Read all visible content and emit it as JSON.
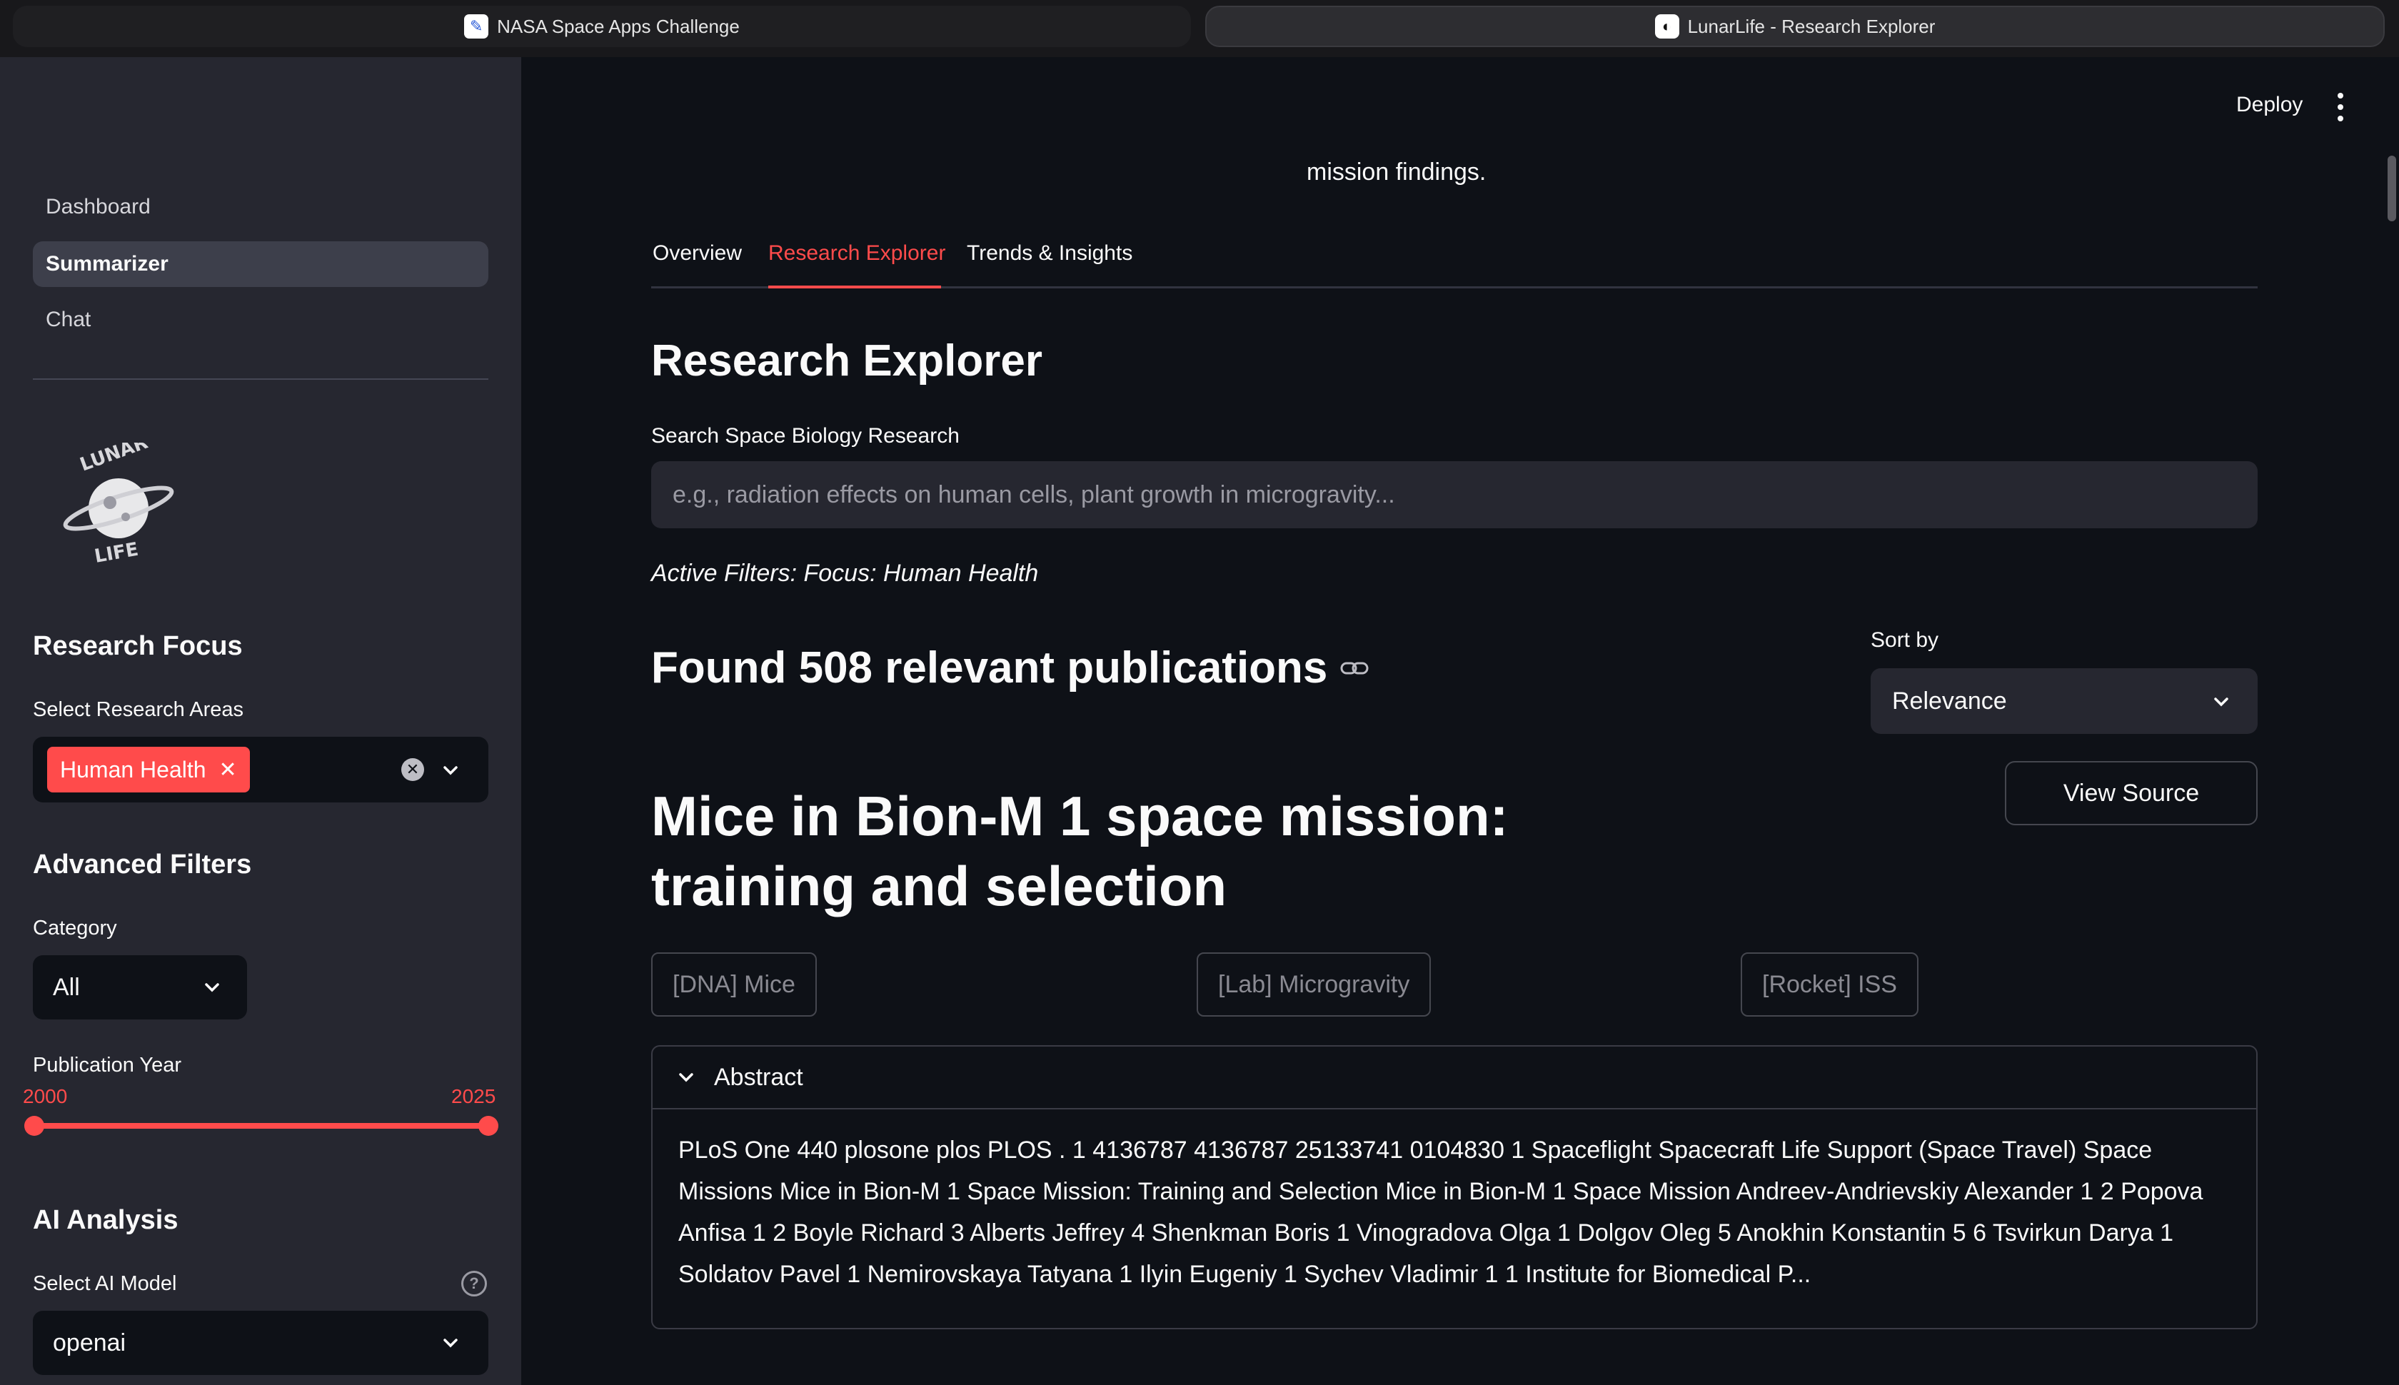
{
  "browser": {
    "tabs": [
      {
        "title": "NASA Space Apps Challenge",
        "icon": "nasa-spaceapps-icon"
      },
      {
        "title": "LunarLife - Research Explorer",
        "icon": "lunarlife-icon"
      }
    ]
  },
  "sidebar": {
    "nav": [
      {
        "label": "Dashboard",
        "active": false
      },
      {
        "label": "Summarizer",
        "active": true
      },
      {
        "label": "Chat",
        "active": false
      }
    ],
    "logo_text": "LUNAR LIFE",
    "research_focus": {
      "heading": "Research Focus",
      "label": "Select Research Areas",
      "selected": [
        "Human Health"
      ]
    },
    "advanced_filters": {
      "heading": "Advanced Filters",
      "category_label": "Category",
      "category_value": "All",
      "year_label": "Publication Year",
      "year_min": "2000",
      "year_max": "2025"
    },
    "ai_analysis": {
      "heading": "AI Analysis",
      "model_label": "Select AI Model",
      "model_value": "openai"
    }
  },
  "header": {
    "deploy_label": "Deploy"
  },
  "main": {
    "intro_tail": "mission findings.",
    "tabs": [
      {
        "label": "Overview",
        "active": false
      },
      {
        "label": "Research Explorer",
        "active": true
      },
      {
        "label": "Trends & Insights",
        "active": false
      }
    ],
    "heading": "Research Explorer",
    "search_label": "Search Space Biology Research",
    "search_placeholder": "e.g., radiation effects on human cells, plant growth in microgravity...",
    "active_filters": "Active Filters: Focus: Human Health",
    "found_text": "Found 508 relevant publications",
    "sort_label": "Sort by",
    "sort_value": "Relevance",
    "view_source_label": "View Source",
    "publication": {
      "title": "Mice in Bion-M 1 space mission: training and selection",
      "tags": [
        "[DNA] Mice",
        "[Lab] Microgravity",
        "[Rocket] ISS"
      ],
      "abstract_label": "Abstract",
      "abstract": "PLoS One 440 plosone plos PLOS . 1 4136787 4136787 25133741 0104830 1 Spaceflight Spacecraft Life Support (Space Travel) Space Missions Mice in Bion-M 1 Space Mission: Training and Selection Mice in Bion-M 1 Space Mission Andreev-Andrievskiy Alexander 1 2 Popova Anfisa 1 2 Boyle Richard 3 Alberts Jeffrey 4 Shenkman Boris 1 Vinogradova Olga 1 Dolgov Oleg 5 Anokhin Konstantin 5 6 Tsvirkun Darya 1 Soldatov Pavel 1 Nemirovskaya Tatyana 1 Ilyin Eugeniy 1 Sychev Vladimir 1 1 Institute for Biomedical P..."
    }
  },
  "colors": {
    "accent": "#ff4b4b",
    "sidebar_bg": "#262730",
    "main_bg": "#0e1117"
  }
}
